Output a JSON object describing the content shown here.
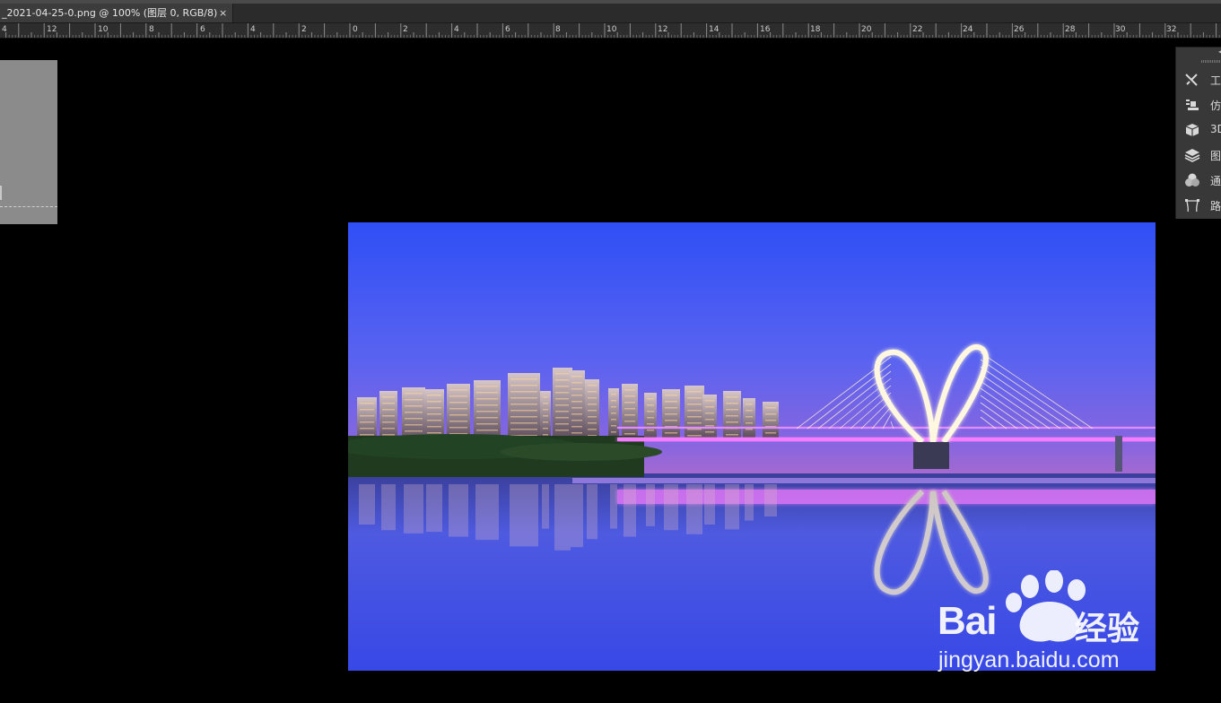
{
  "document_tab": {
    "title": "_2021-04-25-0.png @ 100% (图层 0, RGB/8)",
    "close_label": "×"
  },
  "ruler": {
    "labels": [
      "4",
      "12",
      "10",
      "8",
      "6",
      "4",
      "2",
      "0",
      "2",
      "4",
      "6",
      "8",
      "10",
      "12",
      "14",
      "16",
      "18",
      "20",
      "22",
      "24",
      "26",
      "28",
      "30",
      "32"
    ]
  },
  "panels": [
    {
      "label": "工",
      "icon": "tools-icon"
    },
    {
      "label": "仿",
      "icon": "clone-source-icon"
    },
    {
      "label": "3D",
      "icon": "3d-cube-icon"
    },
    {
      "label": "图",
      "icon": "layers-icon"
    },
    {
      "label": "通",
      "icon": "channels-icon"
    },
    {
      "label": "路",
      "icon": "paths-icon"
    }
  ],
  "watermark": {
    "brand": "Bai",
    "paw_text": "du",
    "suffix": "经验",
    "url": "jingyan.baidu.com"
  },
  "colors": {
    "sky_top": "#2f4ff5",
    "sky_bottom": "#7f63e6",
    "water": "#4a5ae6",
    "bridge_glow": "#f47cff"
  }
}
